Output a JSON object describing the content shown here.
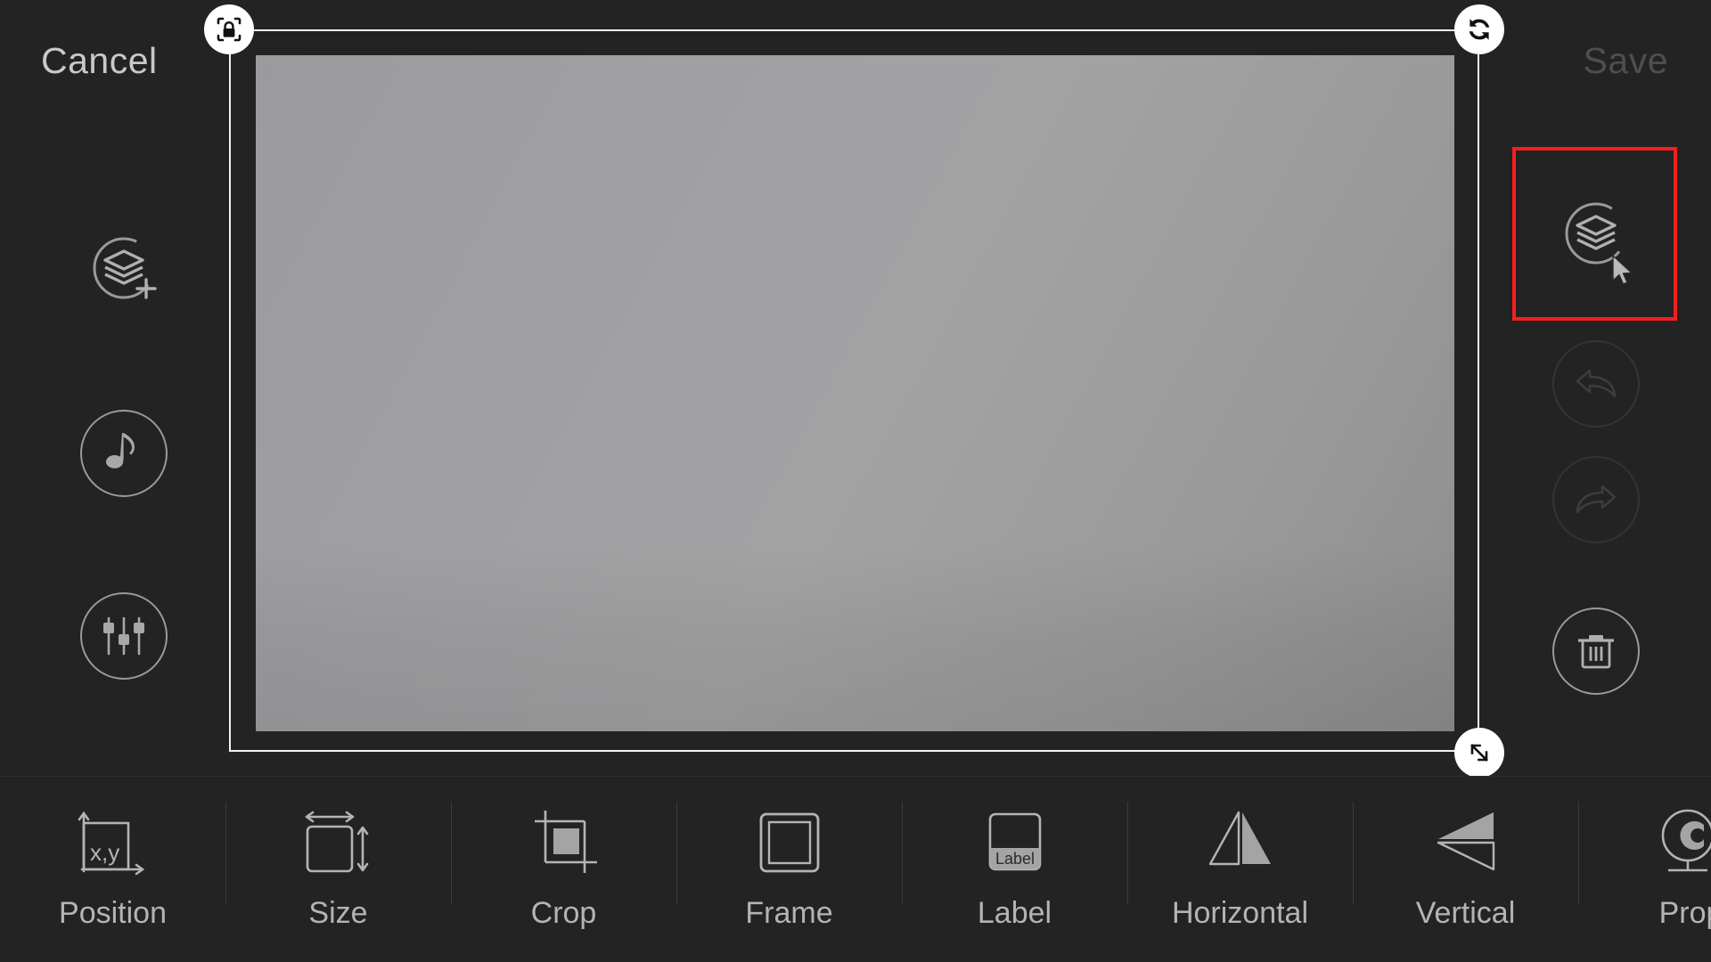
{
  "app": {
    "background_color": "#232323",
    "accent_highlight_color": "#f81e1e"
  },
  "topbar": {
    "cancel_label": "Cancel",
    "save_label": "Save",
    "save_enabled": false
  },
  "canvas": {
    "selection": {
      "lock_handle": "lock-icon",
      "rotate_handle": "rotate-icon",
      "resize_handle": "resize-diagonal-icon"
    },
    "image_placeholder": "gray-photo-layer"
  },
  "left_rail": {
    "items": [
      {
        "name": "add-layer",
        "icon": "layers-plus-icon",
        "enabled": true
      },
      {
        "name": "audio",
        "icon": "music-note-icon",
        "enabled": true
      },
      {
        "name": "adjustments",
        "icon": "sliders-icon",
        "enabled": true
      }
    ]
  },
  "right_rail": {
    "items": [
      {
        "name": "layers",
        "icon": "layers-icon",
        "enabled": true,
        "highlighted": true
      },
      {
        "name": "undo",
        "icon": "undo-arrow-icon",
        "enabled": false
      },
      {
        "name": "redo",
        "icon": "redo-arrow-icon",
        "enabled": false
      },
      {
        "name": "delete",
        "icon": "trash-icon",
        "enabled": true
      }
    ]
  },
  "bottom_toolbar": {
    "items": [
      {
        "label": "Position",
        "icon": "position-xy-icon"
      },
      {
        "label": "Size",
        "icon": "size-arrows-icon"
      },
      {
        "label": "Crop",
        "icon": "crop-icon"
      },
      {
        "label": "Frame",
        "icon": "frame-icon"
      },
      {
        "label": "Label",
        "icon": "label-icon"
      },
      {
        "label": "Horizontal",
        "icon": "flip-horizontal-icon"
      },
      {
        "label": "Vertical",
        "icon": "flip-vertical-icon"
      },
      {
        "label": "Prop",
        "icon": "properties-icon"
      }
    ],
    "label_icon_text": "Label",
    "position_icon_text": "x,y"
  }
}
